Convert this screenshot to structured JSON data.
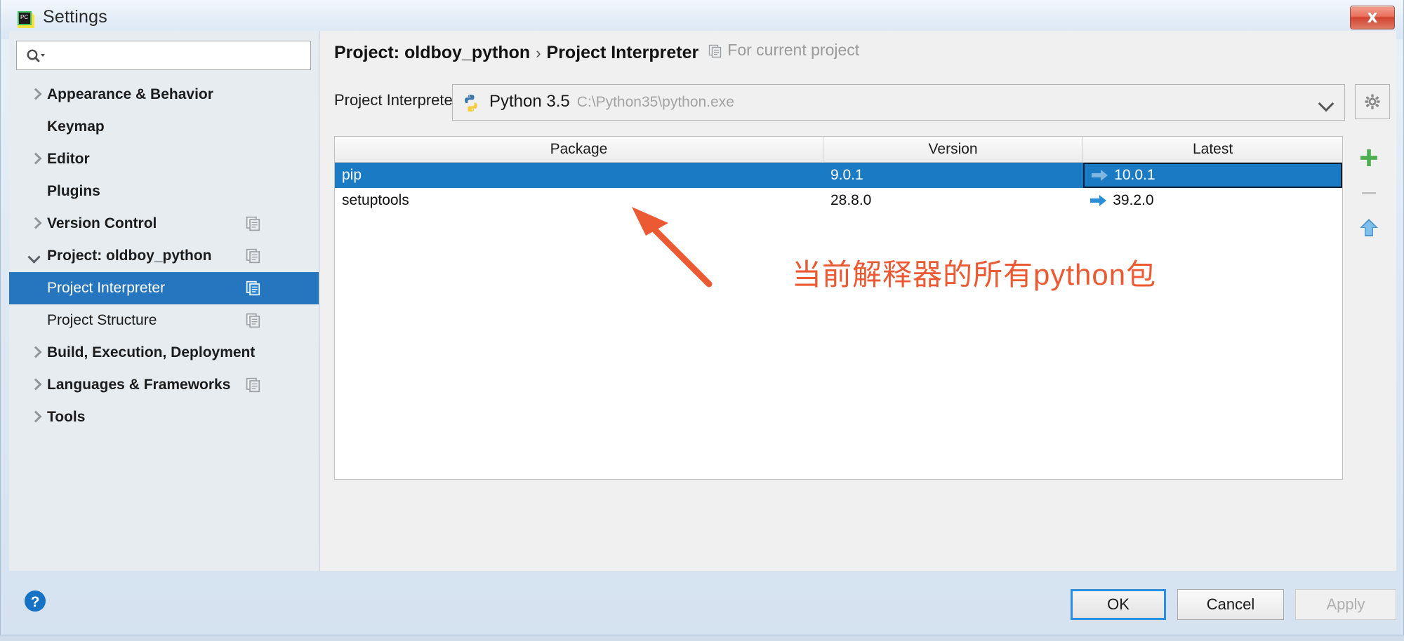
{
  "window": {
    "title": "Settings",
    "app_icon": "pycharm-icon",
    "close_label": "✖"
  },
  "sidebar": {
    "search": {
      "value": "",
      "placeholder": "",
      "icon": "search-icon"
    },
    "items": [
      {
        "label": "Appearance & Behavior",
        "arrow": "right",
        "bold": true,
        "indent": false,
        "selected": false,
        "copy_badge": false
      },
      {
        "label": "Keymap",
        "arrow": "none",
        "bold": true,
        "indent": false,
        "selected": false,
        "copy_badge": false
      },
      {
        "label": "Editor",
        "arrow": "right",
        "bold": true,
        "indent": false,
        "selected": false,
        "copy_badge": false
      },
      {
        "label": "Plugins",
        "arrow": "none",
        "bold": true,
        "indent": false,
        "selected": false,
        "copy_badge": false
      },
      {
        "label": "Version Control",
        "arrow": "right",
        "bold": true,
        "indent": false,
        "selected": false,
        "copy_badge": true
      },
      {
        "label": "Project: oldboy_python",
        "arrow": "down",
        "bold": true,
        "indent": false,
        "selected": false,
        "copy_badge": true
      },
      {
        "label": "Project Interpreter",
        "arrow": "none",
        "bold": false,
        "indent": true,
        "selected": true,
        "copy_badge": true
      },
      {
        "label": "Project Structure",
        "arrow": "none",
        "bold": false,
        "indent": true,
        "selected": false,
        "copy_badge": true
      },
      {
        "label": "Build, Execution, Deployment",
        "arrow": "right",
        "bold": true,
        "indent": false,
        "selected": false,
        "copy_badge": false
      },
      {
        "label": "Languages & Frameworks",
        "arrow": "right",
        "bold": true,
        "indent": false,
        "selected": false,
        "copy_badge": true
      },
      {
        "label": "Tools",
        "arrow": "right",
        "bold": true,
        "indent": false,
        "selected": false,
        "copy_badge": false
      }
    ]
  },
  "main": {
    "breadcrumb": {
      "project": "Project: oldboy_python",
      "separator": "›",
      "page": "Project Interpreter",
      "scope_note": "For current project",
      "scope_icon": "module-copy-icon"
    },
    "interpreter": {
      "label": "Project Interpreter:",
      "icon": "python-logo-icon",
      "name": "Python 3.5",
      "path": "C:\\Python35\\python.exe",
      "dropdown_icon": "chevron-down-icon",
      "settings_icon": "gear-icon"
    },
    "packages_table": {
      "columns": [
        "Package",
        "Version",
        "Latest"
      ],
      "rows": [
        {
          "package": "pip",
          "version": "9.0.1",
          "latest": "10.0.1",
          "selected": true,
          "has_update_arrow": true
        },
        {
          "package": "setuptools",
          "version": "28.8.0",
          "latest": "39.2.0",
          "selected": false,
          "has_update_arrow": true
        }
      ]
    },
    "table_tools": [
      {
        "name": "add-package-button",
        "icon": "plus-icon",
        "enabled": true
      },
      {
        "name": "remove-package-button",
        "icon": "minus-icon",
        "enabled": false
      },
      {
        "name": "upgrade-package-button",
        "icon": "up-arrow-icon",
        "enabled": true
      }
    ]
  },
  "annotation": {
    "text": "当前解释器的所有python包",
    "color": "#ec5a33"
  },
  "footer": {
    "help_icon": "help-question-icon",
    "ok_label": "OK",
    "cancel_label": "Cancel",
    "apply_label": "Apply"
  }
}
